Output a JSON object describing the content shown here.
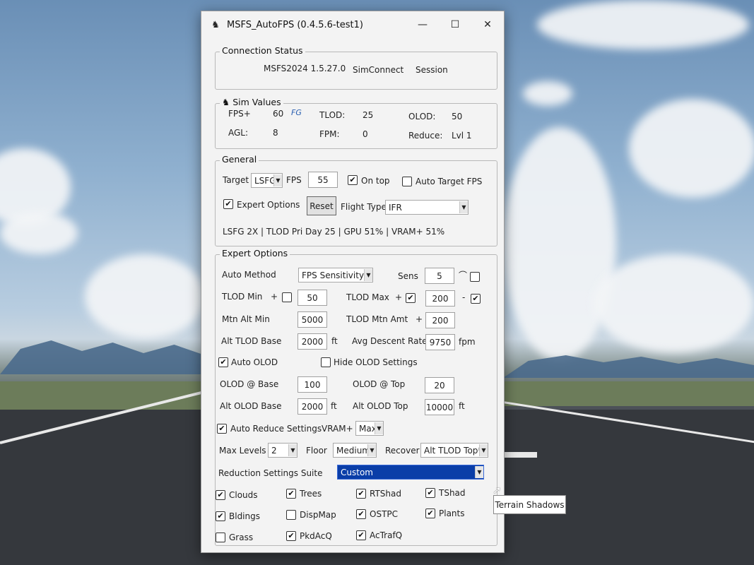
{
  "window": {
    "title": "MSFS_AutoFPS (0.4.5.6-test1)",
    "controls": {
      "minimize": "—",
      "maximize": "☐",
      "close": "✕"
    }
  },
  "connection": {
    "label": "Connection Status",
    "sim": "MSFS2024 1.5.27.0",
    "simconnect": "SimConnect",
    "session": "Session"
  },
  "sim_values": {
    "label": "Sim Values",
    "fps_label": "FPS+",
    "fps": "60",
    "fg_badge": "FG",
    "tlod_label": "TLOD:",
    "tlod": "25",
    "olod_label": "OLOD:",
    "olod": "50",
    "agl_label": "AGL:",
    "agl": "8",
    "fpm_label": "FPM:",
    "fpm": "0",
    "reduce_label": "Reduce:",
    "reduce": "Lvl 1"
  },
  "general": {
    "label": "General",
    "target_label": "Target",
    "target_value": "LSFG",
    "fps_label": "FPS",
    "fps_value": "55",
    "ontop_label": "On top",
    "ontop_checked": true,
    "auto_target_label": "Auto Target FPS",
    "auto_target_checked": false,
    "expert_label": "Expert Options",
    "expert_checked": true,
    "reset_label": "Reset",
    "flight_type_label": "Flight Type",
    "flight_type_value": "IFR",
    "status_line": "LSFG 2X | TLOD Pri Day 25 | GPU 51% | VRAM+ 51%"
  },
  "expert": {
    "label": "Expert Options",
    "auto_method_label": "Auto Method",
    "auto_method_value": "FPS Sensitivity",
    "sens_label": "Sens",
    "sens_value": "5",
    "sens_symbol": "⌒",
    "tlod_min_label": "TLOD Min",
    "tlod_min_plus": "+",
    "tlod_min_value": "50",
    "tlod_max_label": "TLOD Max",
    "tlod_max_plus": "+",
    "tlod_max_value": "200",
    "tlod_max_minus": "-",
    "mtn_alt_min_label": "Mtn Alt Min",
    "mtn_alt_min_value": "5000",
    "tlod_mtn_amt_label": "TLOD Mtn Amt",
    "tlod_mtn_amt_plus": "+",
    "tlod_mtn_amt_value": "200",
    "alt_tlod_base_label": "Alt TLOD Base",
    "alt_tlod_base_value": "2000",
    "ft": "ft",
    "avg_descent_label": "Avg Descent Rate",
    "avg_descent_value": "9750",
    "fpm": "fpm",
    "auto_olod_label": "Auto OLOD",
    "auto_olod_checked": true,
    "hide_olod_label": "Hide OLOD Settings",
    "hide_olod_checked": false,
    "olod_base_label": "OLOD @ Base",
    "olod_base_value": "100",
    "olod_top_label": "OLOD @ Top",
    "olod_top_value": "20",
    "alt_olod_base_label": "Alt OLOD Base",
    "alt_olod_base_value": "2000",
    "alt_olod_top_label": "Alt OLOD Top",
    "alt_olod_top_value": "10000",
    "auto_reduce_label": "Auto Reduce Settings",
    "auto_reduce_checked": true,
    "vram_label": "VRAM+",
    "vram_value": "Max",
    "max_levels_label": "Max Levels",
    "max_levels_value": "2",
    "floor_label": "Floor",
    "floor_value": "Medium",
    "recover_label": "Recover",
    "recover_value": "Alt TLOD Top*",
    "suite_label": "Reduction Settings Suite",
    "suite_value": "Custom",
    "checks": [
      {
        "label": "Clouds",
        "checked": true
      },
      {
        "label": "Trees",
        "checked": true
      },
      {
        "label": "RTShad",
        "checked": true
      },
      {
        "label": "TShad",
        "checked": true
      },
      {
        "label": "Bldings",
        "checked": true
      },
      {
        "label": "DispMap",
        "checked": false
      },
      {
        "label": "OSTPC",
        "checked": true
      },
      {
        "label": "Plants",
        "checked": true
      },
      {
        "label": "Grass",
        "checked": false
      },
      {
        "label": "PkdAcQ",
        "checked": true
      },
      {
        "label": "AcTrafQ",
        "checked": true
      }
    ]
  },
  "tooltip": "Terrain Shadows",
  "colors": {
    "selection": "#0a3ea8",
    "window_bg": "#f3f3f3"
  }
}
